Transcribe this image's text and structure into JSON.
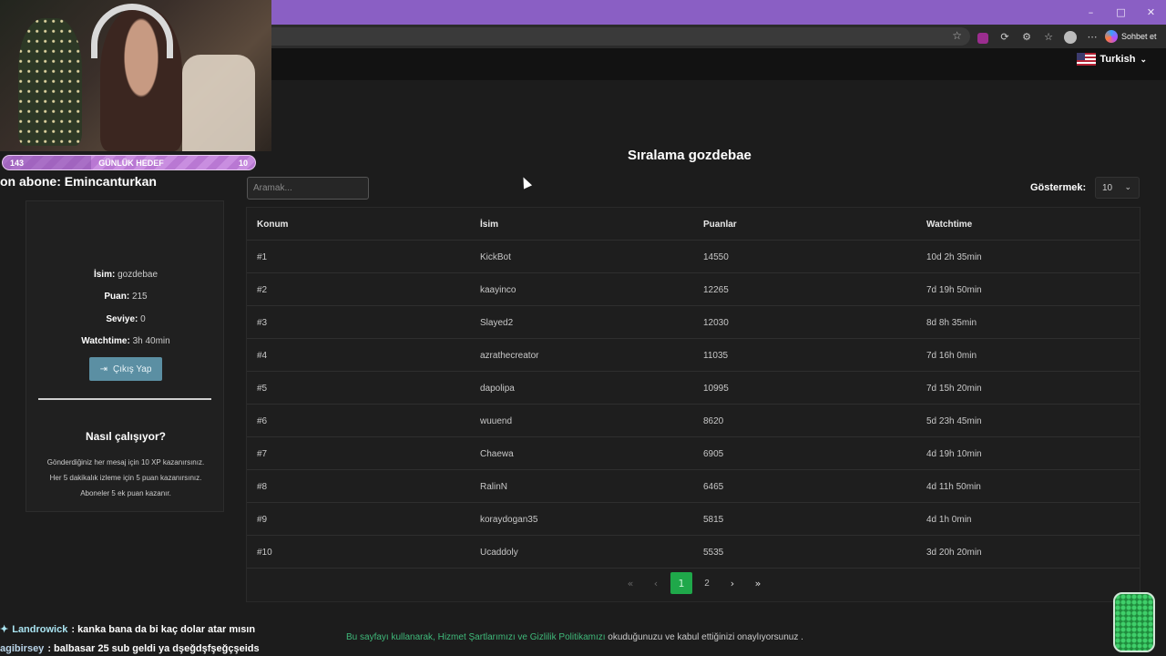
{
  "browser": {
    "extension_button_label": "Sohbet et",
    "window_controls": [
      "–",
      "□",
      "✕"
    ]
  },
  "header": {
    "language": "Turkish"
  },
  "page": {
    "title": "Sıralama gozdebae",
    "search_placeholder": "Aramak...",
    "show_label": "Göstermek:",
    "show_value": "10"
  },
  "table": {
    "headers": [
      "Konum",
      "İsim",
      "Puanlar",
      "Watchtime"
    ],
    "rows": [
      [
        "#1",
        "KickBot",
        "14550",
        "10d 2h 35min"
      ],
      [
        "#2",
        "kaayinco",
        "12265",
        "7d 19h 50min"
      ],
      [
        "#3",
        "Slayed2",
        "12030",
        "8d 8h 35min"
      ],
      [
        "#4",
        "azrathecreator",
        "11035",
        "7d 16h 0min"
      ],
      [
        "#5",
        "dapolipa",
        "10995",
        "7d 15h 20min"
      ],
      [
        "#6",
        "wuuend",
        "8620",
        "5d 23h 45min"
      ],
      [
        "#7",
        "Chaewa",
        "6905",
        "4d 19h 10min"
      ],
      [
        "#8",
        "RalinN",
        "6465",
        "4d 11h 50min"
      ],
      [
        "#9",
        "koraydogan35",
        "5815",
        "4d 1h 0min"
      ],
      [
        "#10",
        "Ucaddoly",
        "5535",
        "3d 20h 20min"
      ]
    ]
  },
  "pagination": {
    "first": "«",
    "prev": "‹",
    "pages": [
      "1",
      "2"
    ],
    "next": "›",
    "last": "»",
    "current": "1"
  },
  "footer": {
    "prefix": "Bu sayfayı kullanarak, ",
    "link": "Hizmet Şartlarımızı ve Gizlilik Politikamızı",
    "suffix": " okuduğunuzu ve kabul ettiğinizi onaylıyorsunuz ."
  },
  "stream": {
    "goal_left": "143",
    "goal_label": "GÜNLÜK HEDEF",
    "goal_right": "10",
    "sub_ticker": "on abone: Emincanturkan",
    "chat": [
      {
        "user": "Landrowick",
        "message": ": kanka bana da bi kaç dolar atar mısın"
      },
      {
        "user": "agibirsey",
        "message": ": balbasar 25 sub geldi ya dşeğdşfşeğçşeids"
      }
    ]
  },
  "profile": {
    "name_label": "İsim:",
    "name_value": "gozdebae",
    "points_label": "Puan:",
    "points_value": "215",
    "level_label": "Seviye:",
    "level_value": "0",
    "watchtime_label": "Watchtime:",
    "watchtime_value": "3h 40min",
    "logout_label": "Çıkış Yap",
    "how_title": "Nasıl çalışıyor?",
    "how_lines": [
      "Gönderdiğiniz her mesaj için 10 XP kazanırsınız.",
      "Her 5 dakikalık izleme için 5 puan kazanırsınız.",
      "Aboneler 5 ek puan kazanır."
    ]
  },
  "colors": {
    "accent_green": "#1fa84a",
    "titlebar_purple": "#8a5fc4",
    "button_blue": "#5b8fa3"
  }
}
